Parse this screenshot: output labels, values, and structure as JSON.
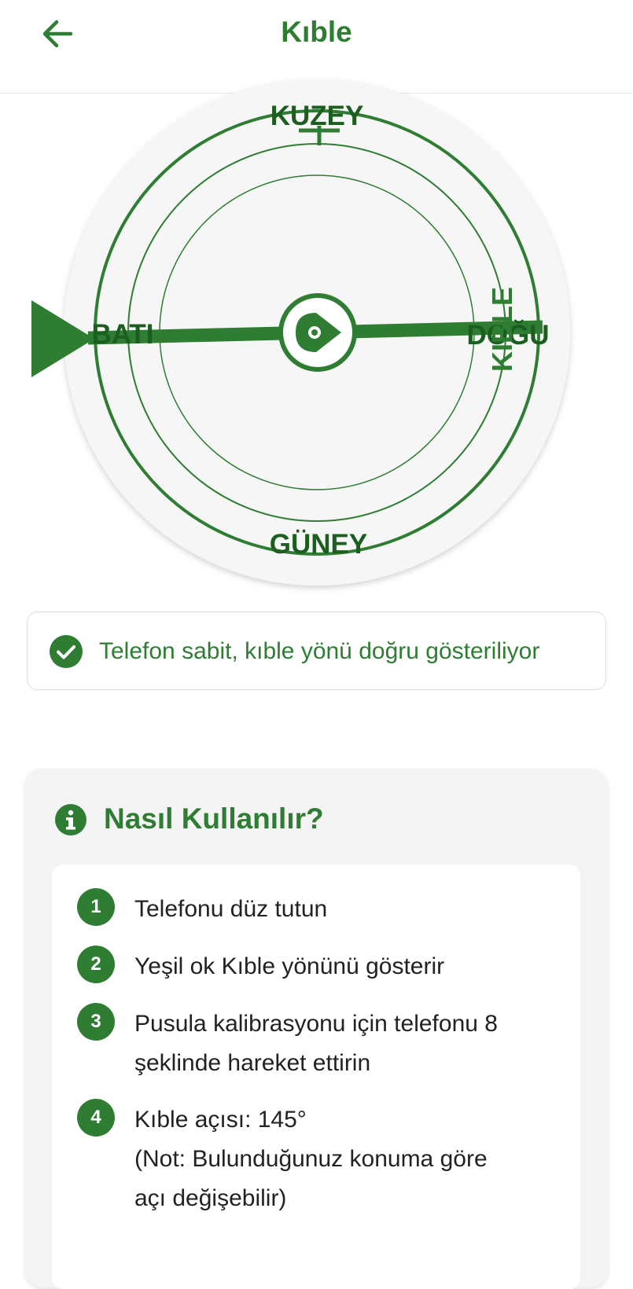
{
  "header": {
    "title": "Kıble",
    "back_icon": "arrow-left-icon"
  },
  "compass": {
    "north": "KUZEY",
    "south": "GÜNEY",
    "east": "DOĞU",
    "west": "BATI",
    "qibla_label": "KIBLE",
    "qibla_angle_deg": 145,
    "accent_color": "#2e7d32"
  },
  "status": {
    "icon": "check-circle-icon",
    "text": "Telefon sabit, kıble yönü doğru gösteriliyor"
  },
  "help": {
    "icon": "info-icon",
    "title": "Nasıl Kullanılır?",
    "steps": [
      {
        "num": "1",
        "line1": "Telefonu düz tutun"
      },
      {
        "num": "2",
        "line1": "Yeşil ok Kıble yönünü gösterir"
      },
      {
        "num": "3",
        "line1": "Pusula kalibrasyonu için telefonu 8",
        "line2": "şeklinde hareket ettirin"
      },
      {
        "num": "4",
        "line1": "Kıble açısı: 145°",
        "line2": "(Not: Bulunduğunuz konuma göre",
        "line3": "açı değişebilir)"
      }
    ]
  }
}
